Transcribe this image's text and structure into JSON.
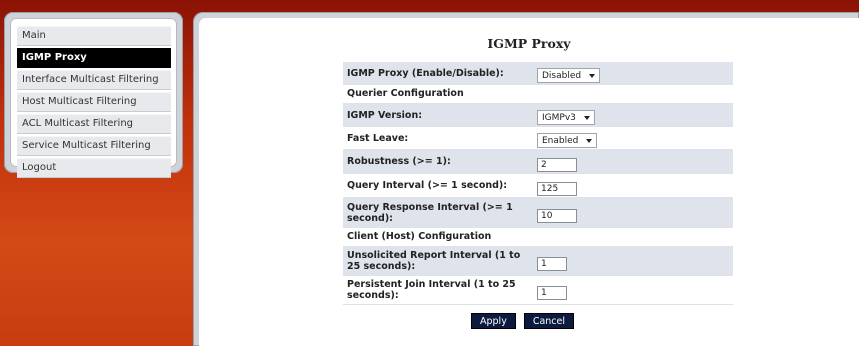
{
  "sidebar": {
    "items": [
      {
        "label": "Main",
        "active": false
      },
      {
        "label": "IGMP Proxy",
        "active": true
      },
      {
        "label": "Interface Multicast Filtering",
        "active": false
      },
      {
        "label": "Host Multicast Filtering",
        "active": false
      },
      {
        "label": "ACL Multicast Filtering",
        "active": false
      },
      {
        "label": "Service Multicast Filtering",
        "active": false
      },
      {
        "label": "Logout",
        "active": false
      }
    ]
  },
  "page": {
    "title": "IGMP Proxy"
  },
  "form": {
    "igmp_proxy": {
      "label": "IGMP Proxy (Enable/Disable):",
      "value": "Disabled"
    },
    "querier_section": "Querier Configuration",
    "igmp_version": {
      "label": "IGMP Version:",
      "value": "IGMPv3"
    },
    "fast_leave": {
      "label": "Fast Leave:",
      "value": "Enabled"
    },
    "robustness": {
      "label": "Robustness (>= 1):",
      "value": "2"
    },
    "query_interval": {
      "label": "Query Interval (>= 1 second):",
      "value": "125"
    },
    "query_response_interval": {
      "label": "Query Response Interval (>= 1 second):",
      "value": "10"
    },
    "client_section": "Client (Host) Configuration",
    "unsolicited_report_interval": {
      "label": "Unsolicited Report Interval (1 to 25 seconds):",
      "value": "1"
    },
    "persistent_join_interval": {
      "label": "Persistent Join Interval (1 to 25 seconds):",
      "value": "1"
    }
  },
  "buttons": {
    "apply": "Apply",
    "cancel": "Cancel"
  }
}
